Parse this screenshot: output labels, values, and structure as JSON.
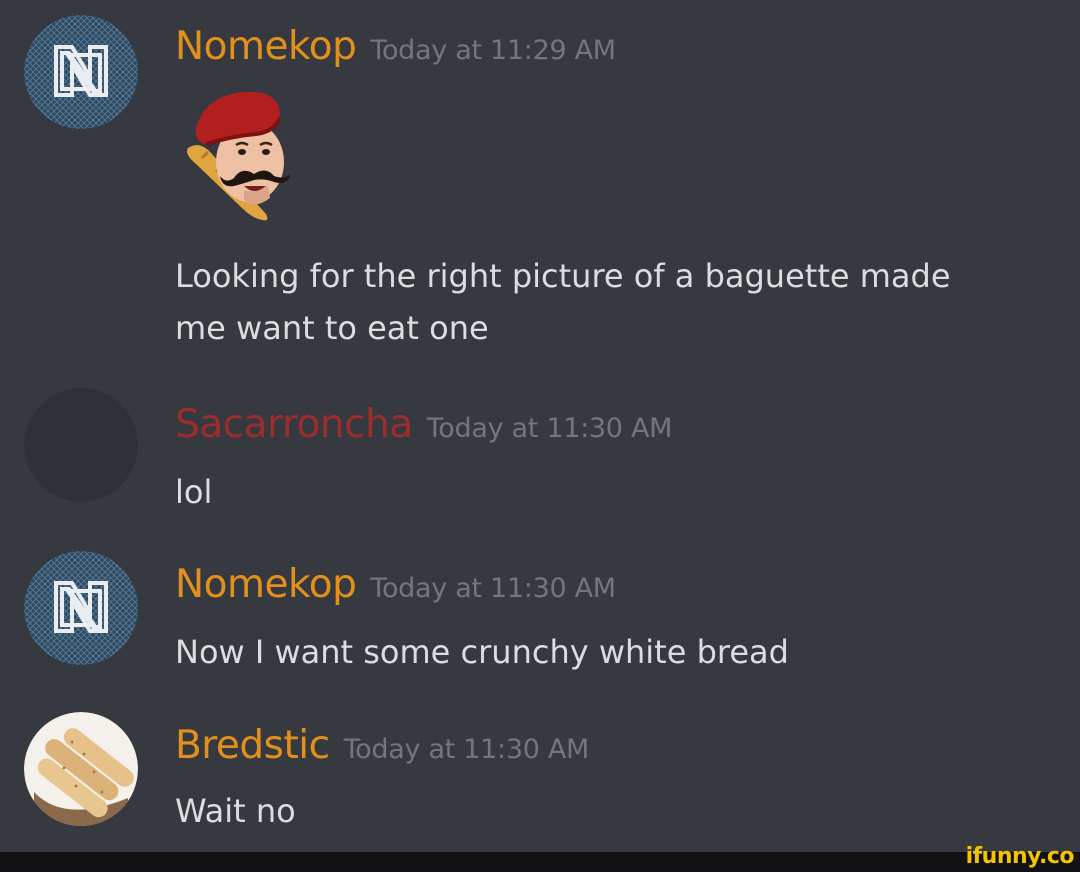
{
  "messages": [
    {
      "username": "Nomekop",
      "timestamp": "Today at 11:29 AM",
      "avatar_icon": "nomekop-logo-icon",
      "emoji_icon": "baguette-mustache-beret-emoji",
      "lines": [
        "Looking for the right picture of a baguette made",
        "me want to eat one"
      ]
    },
    {
      "username": "Sacarroncha",
      "timestamp": "Today at 11:30 AM",
      "avatar_icon": "blank-avatar",
      "lines": [
        "lol"
      ]
    },
    {
      "username": "Nomekop",
      "timestamp": "Today at 11:30 AM",
      "avatar_icon": "nomekop-logo-icon",
      "lines": [
        "Now I want some crunchy white bread"
      ]
    },
    {
      "username": "Bredstic",
      "timestamp": "Today at 11:30 AM",
      "avatar_icon": "breadsticks-photo-avatar",
      "lines": [
        "Wait no"
      ]
    }
  ],
  "watermark": "ifunny.co",
  "colors": {
    "background": "#36393f",
    "username_orange": "#e2901c",
    "username_red": "#9b2d2d",
    "timestamp": "#72767d",
    "message_text": "#dcddde",
    "watermark": "#f2c500"
  }
}
